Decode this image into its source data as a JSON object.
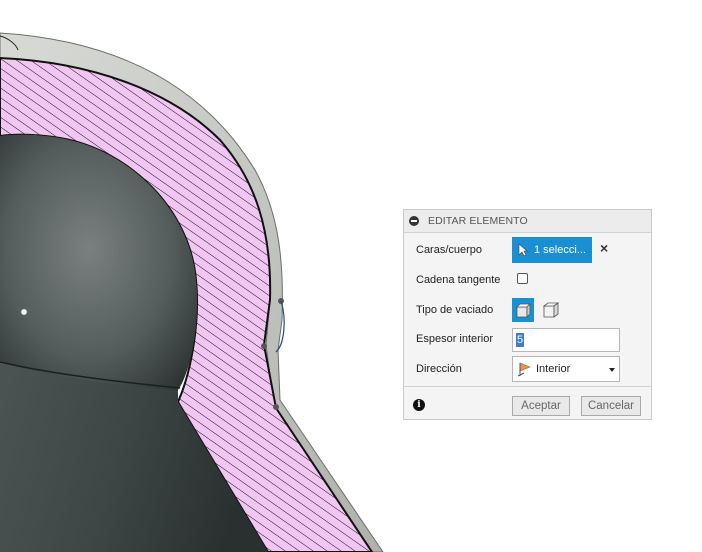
{
  "panel": {
    "title": "EDITAR ELEMENTO",
    "rows": {
      "faces": {
        "label": "Caras/cuerpo",
        "button_text": "1 selecci...",
        "clear_icon": "close-icon"
      },
      "tangent_chain": {
        "label": "Cadena tangente",
        "checked": false
      },
      "hollow_type": {
        "label": "Tipo de vaciado",
        "selected": "solid-shell-icon",
        "alternate": "surface-shell-icon"
      },
      "inner_thickness": {
        "label": "Espesor interior",
        "value": "5"
      },
      "direction": {
        "label": "Dirección",
        "value": "Interior",
        "icon": "direction-inside-icon"
      }
    },
    "footer": {
      "info_icon": "info-icon",
      "ok_label": "Aceptar",
      "cancel_label": "Cancelar"
    }
  },
  "colors": {
    "accent": "#1b8fd4",
    "section_fill": "#f2c6f2",
    "hatch": "#111111",
    "body_dark": "#4a5050"
  }
}
